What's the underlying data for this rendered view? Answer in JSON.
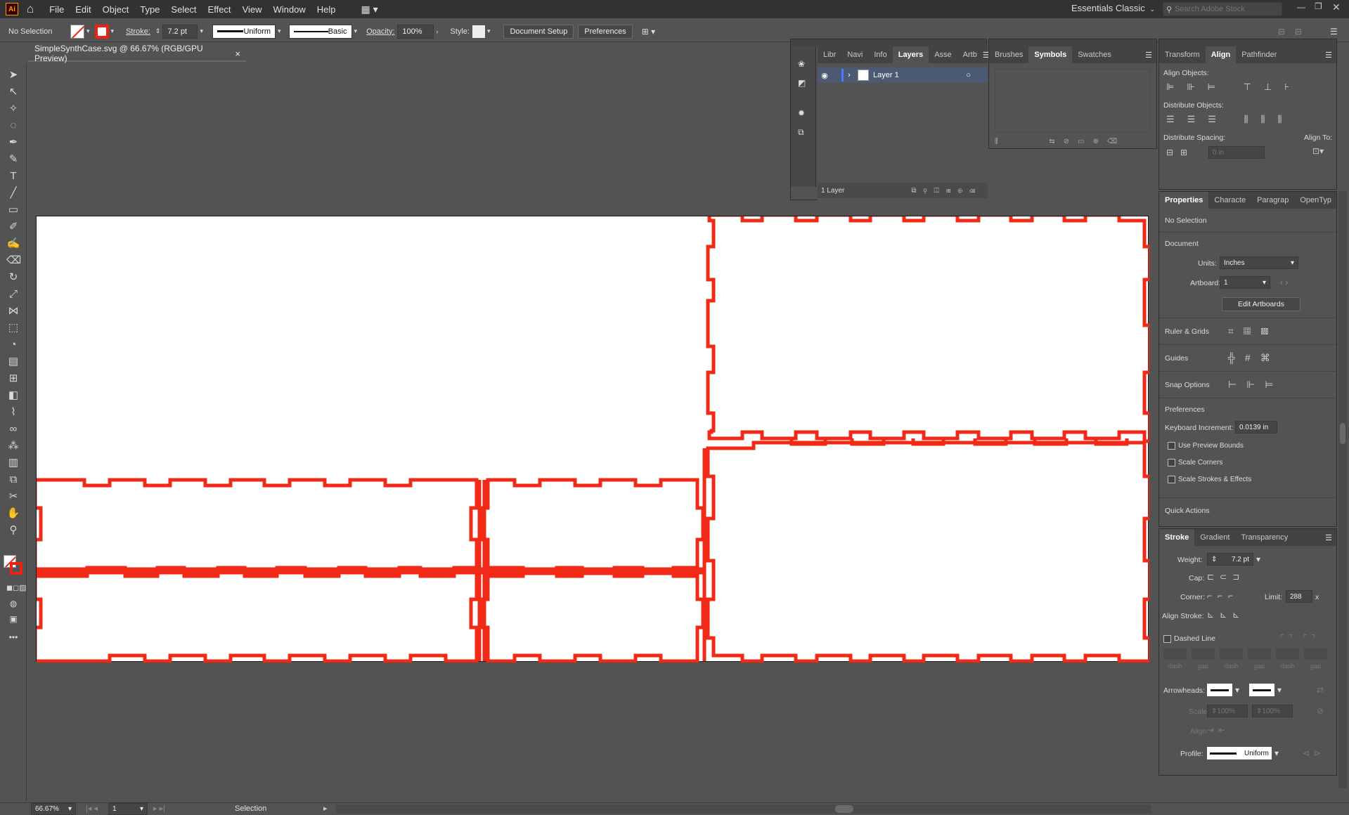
{
  "menu": {
    "logo": "Ai",
    "items": [
      "File",
      "Edit",
      "Object",
      "Type",
      "Select",
      "Effect",
      "View",
      "Window",
      "Help"
    ],
    "workspace": "Essentials Classic",
    "search_placeholder": "Search Adobe Stock"
  },
  "control": {
    "selection": "No Selection",
    "stroke_label": "Stroke:",
    "stroke_value": "7.2 pt",
    "profile": "Uniform",
    "brush": "Basic",
    "opacity_label": "Opacity:",
    "opacity_value": "100%",
    "style_label": "Style:",
    "document_setup": "Document Setup",
    "preferences": "Preferences",
    "stroke_color": "#ee2211"
  },
  "document": {
    "tab_title": "SimpleSynthCase.svg @ 66.67% (RGB/GPU Preview)",
    "close": "×"
  },
  "layers_panel": {
    "tabs": [
      "Libr",
      "Navi",
      "Info",
      "Layers",
      "Asse",
      "Artb"
    ],
    "active_tab": "Layers",
    "layer_name": "Layer 1",
    "footer": "1 Layer"
  },
  "symbols_panel": {
    "tabs": [
      "Brushes",
      "Symbols",
      "Swatches"
    ],
    "active_tab": "Symbols"
  },
  "align_panel": {
    "tabs": [
      "Transform",
      "Align",
      "Pathfinder"
    ],
    "active_tab": "Align",
    "align_objects": "Align Objects:",
    "distribute_objects": "Distribute Objects:",
    "distribute_spacing": "Distribute Spacing:",
    "align_to": "Align To:",
    "spacing_value": "0 in"
  },
  "properties_panel": {
    "tabs": [
      "Properties",
      "Characte",
      "Paragrap",
      "OpenTyp"
    ],
    "active_tab": "Properties",
    "no_selection": "No Selection",
    "document": "Document",
    "units_label": "Units:",
    "units_value": "Inches",
    "artboard_label": "Artboard:",
    "artboard_value": "1",
    "edit_artboards": "Edit Artboards",
    "ruler_grids": "Ruler & Grids",
    "guides": "Guides",
    "snap_options": "Snap Options",
    "preferences": "Preferences",
    "keyboard_increment_label": "Keyboard Increment:",
    "keyboard_increment_value": "0.0139 in",
    "use_preview_bounds": "Use Preview Bounds",
    "scale_corners": "Scale Corners",
    "scale_strokes": "Scale Strokes & Effects",
    "quick_actions": "Quick Actions"
  },
  "stroke_panel": {
    "tabs": [
      "Stroke",
      "Gradient",
      "Transparency"
    ],
    "active_tab": "Stroke",
    "weight_label": "Weight:",
    "weight_value": "7.2 pt",
    "cap_label": "Cap:",
    "corner_label": "Corner:",
    "limit_label": "Limit:",
    "limit_value": "288",
    "limit_unit": "x",
    "align_stroke_label": "Align Stroke:",
    "dashed_line": "Dashed Line",
    "dash_labels": [
      "dash",
      "gap",
      "dash",
      "gap",
      "dash",
      "gap"
    ],
    "arrowheads_label": "Arrowheads:",
    "scale_label": "Scale:",
    "scale_value_1": "100%",
    "scale_value_2": "100%",
    "align_label": "Align:",
    "profile_label": "Profile:",
    "profile_value": "Uniform"
  },
  "status": {
    "zoom": "66.67%",
    "artboard": "1",
    "tool": "Selection"
  }
}
